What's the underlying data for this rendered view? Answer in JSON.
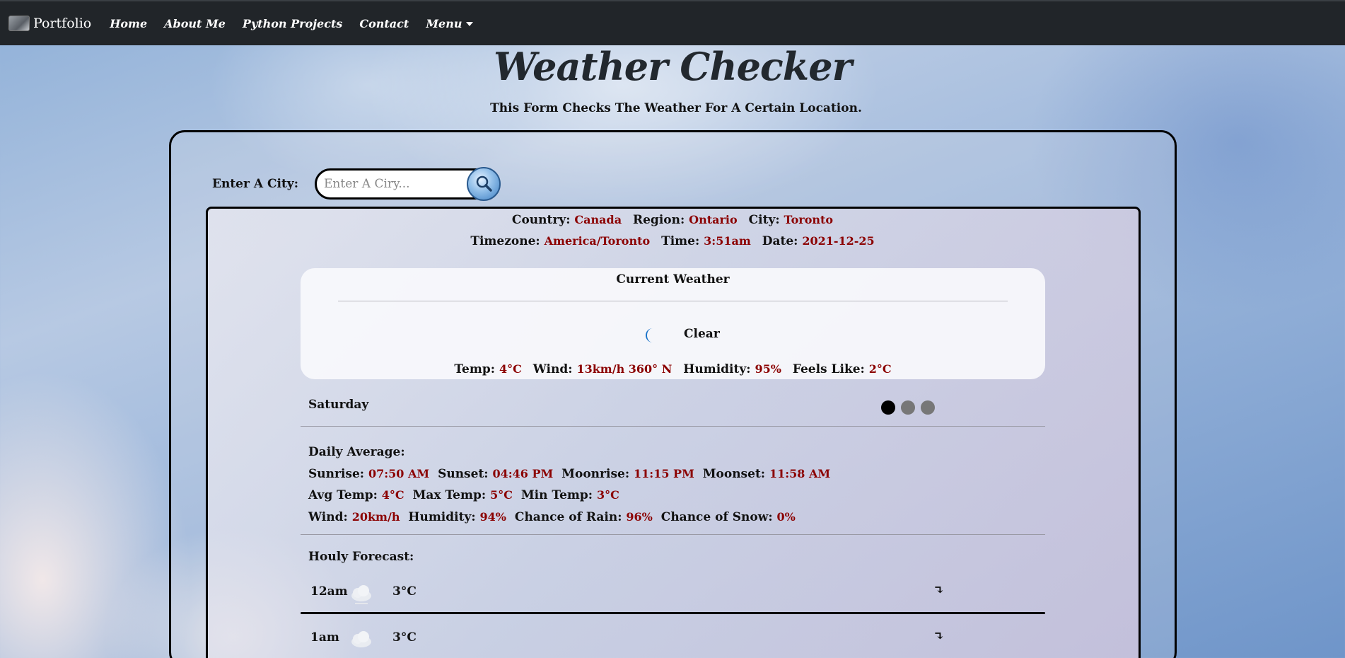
{
  "navbar": {
    "brand": "Portfolio",
    "links": [
      "Home",
      "About Me",
      "Python Projects",
      "Contact"
    ],
    "menu_label": "Menu"
  },
  "header": {
    "title": "Weather Checker",
    "subtitle": "This Form Checks The Weather For A Certain Location."
  },
  "search": {
    "label": "Enter A City:",
    "placeholder": "Enter A Ciry..."
  },
  "location": {
    "country_label": "Country:",
    "country": "Canada",
    "region_label": "Region:",
    "region": "Ontario",
    "city_label": "City:",
    "city": "Toronto",
    "timezone_label": "Timezone:",
    "timezone": "America/Toronto",
    "time_label": "Time:",
    "time": "3:51am",
    "date_label": "Date:",
    "date": "2021-12-25"
  },
  "current": {
    "title": "Current Weather",
    "condition": "Clear",
    "icon": "moon-icon",
    "temp_label": "Temp:",
    "temp": "4°C",
    "wind_label": "Wind:",
    "wind": "13km/h 360° N",
    "humidity_label": "Humidity:",
    "humidity": "95%",
    "feels_label": "Feels Like:",
    "feels": "2°C"
  },
  "forecast": {
    "day": "Saturday",
    "dots": 3,
    "active_dot": 0,
    "daily_title": "Daily Average:",
    "sunrise_label": "Sunrise:",
    "sunrise": "07:50 AM",
    "sunset_label": "Sunset:",
    "sunset": "04:46 PM",
    "moonrise_label": "Moonrise:",
    "moonrise": "11:15 PM",
    "moonset_label": "Moonset:",
    "moonset": "11:58 AM",
    "avg_temp_label": "Avg Temp:",
    "avg_temp": "4°C",
    "max_temp_label": "Max Temp:",
    "max_temp": "5°C",
    "min_temp_label": "Min Temp:",
    "min_temp": "3°C",
    "wind_label": "Wind:",
    "wind": "20km/h",
    "humidity_label": "Humidity:",
    "humidity": "94%",
    "rain_label": "Chance of Rain:",
    "rain": "96%",
    "snow_label": "Chance of Snow:",
    "snow": "0%",
    "hourly_title": "Houly Forecast:",
    "hours": [
      {
        "time": "12am",
        "temp": "3°C",
        "icon": "cloud-icon",
        "expand": "↴"
      },
      {
        "time": "1am",
        "temp": "3°C",
        "icon": "cloud-icon",
        "expand": "↴"
      }
    ]
  },
  "colors": {
    "navbar_bg": "#212529",
    "value_red": "#8b0000"
  }
}
